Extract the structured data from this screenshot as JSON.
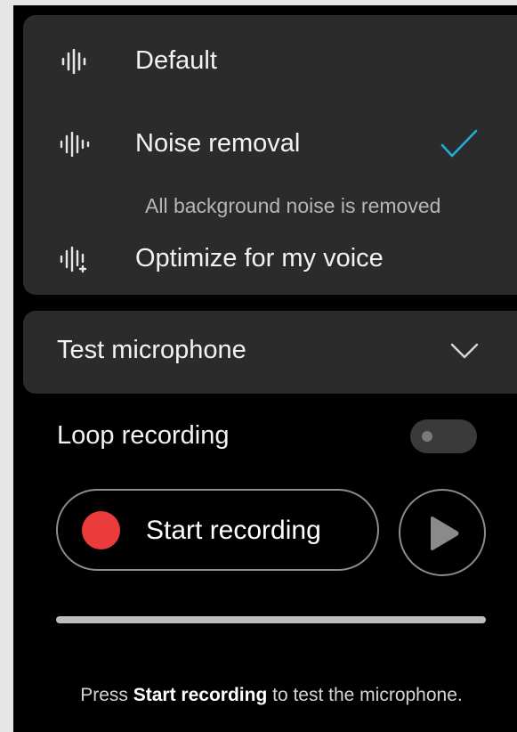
{
  "noise_options": {
    "items": [
      {
        "label": "Default",
        "icon": "audio-waveform-icon",
        "selected": false
      },
      {
        "label": "Noise removal",
        "icon": "noise-removal-waveform-icon",
        "selected": true
      },
      {
        "label": "Optimize for my voice",
        "icon": "voice-optimize-waveform-icon",
        "selected": false
      }
    ],
    "selected_description": "All background noise is removed",
    "check_icon": "checkmark-icon"
  },
  "test_microphone": {
    "label": "Test microphone",
    "expand_icon": "chevron-down-icon"
  },
  "loop_recording": {
    "label": "Loop recording",
    "enabled": false
  },
  "recording": {
    "start_label": "Start recording",
    "record_icon": "record-dot-icon",
    "play_icon": "play-icon",
    "level": 0
  },
  "hint": {
    "prefix": "Press ",
    "emphasis": "Start recording",
    "suffix": " to test the microphone."
  },
  "colors": {
    "accent": "#1cb0d8",
    "record": "#ec3b3b",
    "card_bg": "#2b2b2b",
    "panel_bg": "#000000"
  }
}
